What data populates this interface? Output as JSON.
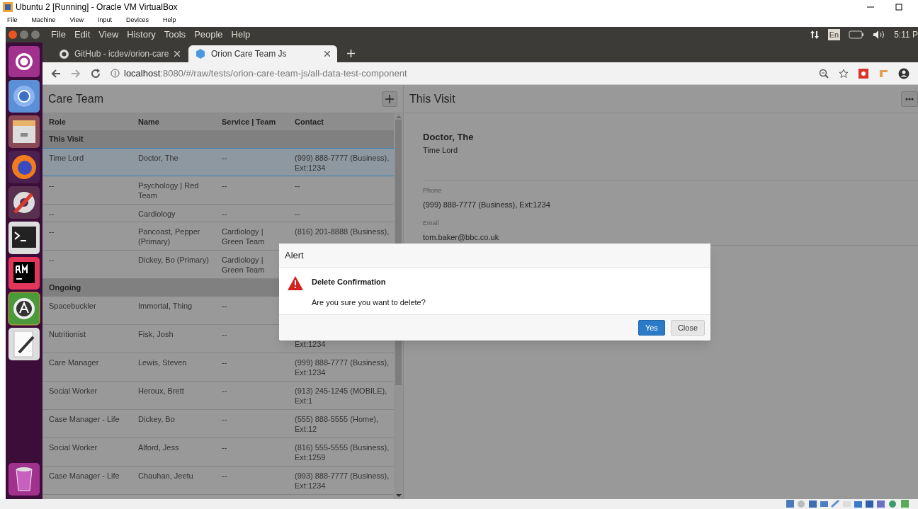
{
  "vbox": {
    "title": "Ubuntu 2 [Running] - Oracle VM VirtualBox",
    "menu": [
      "File",
      "Machine",
      "View",
      "Input",
      "Devices",
      "Help"
    ]
  },
  "ubuntu": {
    "menu": [
      "File",
      "Edit",
      "View",
      "History",
      "Tools",
      "People",
      "Help"
    ],
    "keyboard": "En",
    "clock": "5:11 P"
  },
  "tabs": [
    {
      "title": "GitHub - icdev/orion-care",
      "selected": false
    },
    {
      "title": "Orion Care Team Js",
      "selected": true
    }
  ],
  "url": {
    "host": "localhost",
    "path": ":8080/#/raw/tests/orion-care-team-js/all-data-test-component"
  },
  "care_team": {
    "title": "Care Team",
    "columns": [
      "Role",
      "Name",
      "Service | Team",
      "Contact"
    ],
    "groups": [
      {
        "label": "This Visit",
        "rows": [
          {
            "role": "Time Lord",
            "name": "Doctor, The",
            "service": "--",
            "contact": "(999) 888-7777 (Business), Ext:1234",
            "selected": true
          },
          {
            "role": "--",
            "name": "Psychology | Red Team",
            "service": "--",
            "contact": "--",
            "selected": false
          },
          {
            "role": "--",
            "name": "Cardiology",
            "service": "--",
            "contact": "--",
            "selected": false
          },
          {
            "role": "--",
            "name": "Pancoast, Pepper (Primary)",
            "service": "Cardiology | Green Team",
            "contact": "(816) 201-8888 (Business),",
            "selected": false
          },
          {
            "role": "--",
            "name": "Dickey, Bo (Primary)",
            "service": "Cardiology | Green Team",
            "selected": false
          }
        ]
      },
      {
        "label": "Ongoing",
        "rows": [
          {
            "role": "Spacebuckler",
            "name": "Immortal, Thing",
            "service": "--",
            "selected": false
          },
          {
            "role": "Nutritionist",
            "name": "Fisk, Josh",
            "service": "--",
            "contact": "Ext:1234",
            "selected": false
          },
          {
            "role": "Care Manager",
            "name": "Lewis, Steven",
            "service": "--",
            "contact": "(999) 888-7777 (Business), Ext:1234",
            "selected": false
          },
          {
            "role": "Social Worker",
            "name": "Heroux, Brett",
            "service": "--",
            "contact": "(913) 245-1245 (MOBILE), Ext:1",
            "selected": false
          },
          {
            "role": "Case Manager - Life",
            "name": "Dickey, Bo",
            "service": "--",
            "contact": "(555) 888-5555 (Home), Ext:12",
            "selected": false
          },
          {
            "role": "Social Worker",
            "name": "Alford, Jess",
            "service": "--",
            "contact": "(816) 555-5555 (Business), Ext:1259",
            "selected": false
          },
          {
            "role": "Case Manager - Life",
            "name": "Chauhan, Jeetu",
            "service": "--",
            "contact": "(993) 888-7777 (Business), Ext:1234",
            "selected": false
          }
        ]
      }
    ]
  },
  "detail": {
    "title": "This Visit",
    "name": "Doctor, The",
    "role": "Time Lord",
    "fields": [
      {
        "label": "Phone",
        "value": "(999) 888-7777 (Business), Ext:1234"
      },
      {
        "label": "Email",
        "value": "tom.baker@bbc.co.uk"
      }
    ]
  },
  "dialog": {
    "title": "Alert",
    "heading": "Delete Confirmation",
    "message": "Are you sure you want to delete?",
    "buttons": [
      {
        "label": "Yes",
        "kind": "primary"
      },
      {
        "label": "Close",
        "kind": "default"
      }
    ]
  }
}
